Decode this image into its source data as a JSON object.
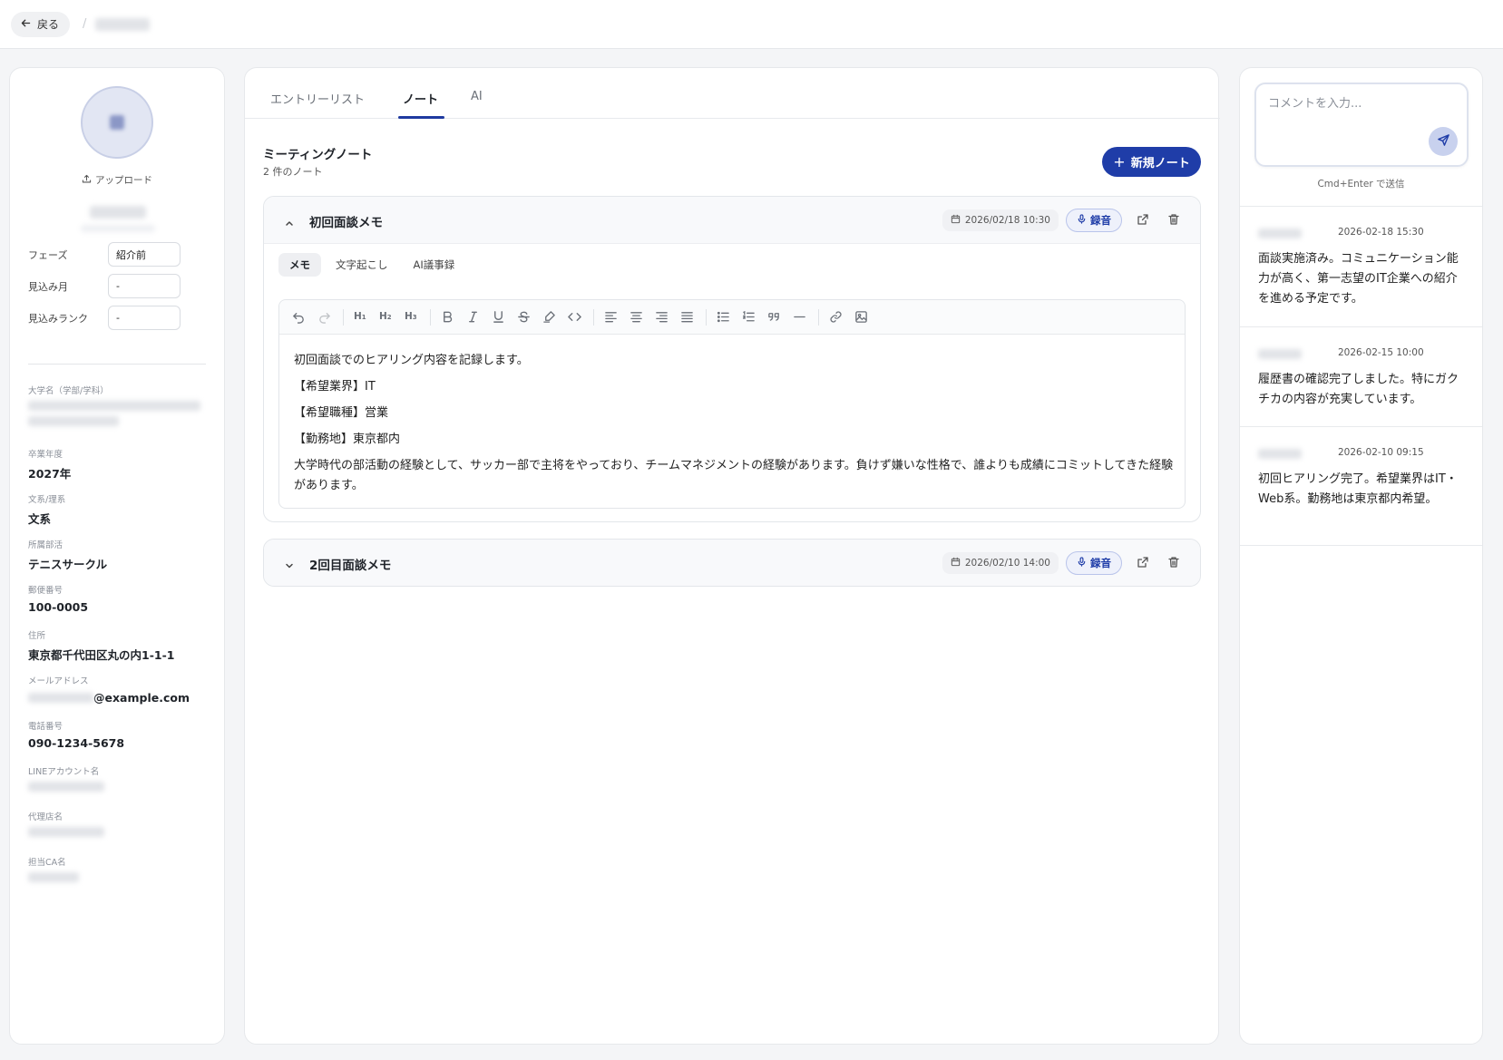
{
  "header": {
    "back_label": "戻る",
    "breadcrumb_separator": "/"
  },
  "profile": {
    "upload_label": "アップロード",
    "fields": [
      {
        "label": "フェーズ",
        "value": "紹介前"
      },
      {
        "label": "見込み月",
        "value": "-"
      },
      {
        "label": "見込みランク",
        "value": "-"
      }
    ],
    "info": {
      "university_label": "大学名（学部/学科）",
      "grad_year_label": "卒業年度",
      "grad_year": "2027年",
      "track_label": "文系/理系",
      "track": "文系",
      "club_label": "所属部活",
      "club": "テニスサークル",
      "postal_label": "郵便番号",
      "postal": "100-0005",
      "address_label": "住所",
      "address": "東京都千代田区丸の内1-1-1",
      "email_label": "メールアドレス",
      "email_domain": "@example.com",
      "phone_label": "電話番号",
      "phone": "090-1234-5678",
      "line_label": "LINEアカウント名",
      "agency_label": "代理店名",
      "ca_label": "担当CA名"
    }
  },
  "tabs": [
    {
      "label": "エントリーリスト"
    },
    {
      "label": "ノート"
    },
    {
      "label": "AI"
    }
  ],
  "notes_section": {
    "title": "ミーティングノート",
    "count": "2 件のノート",
    "new_button": "新規ノート",
    "plus": "+"
  },
  "notes": [
    {
      "title": "初回面談メモ",
      "date": "2026/02/18 10:30",
      "record_label": "録音",
      "subtabs": [
        "メモ",
        "文字起こし",
        "AI議事録"
      ],
      "toolbar": {
        "h1": "H",
        "h2": "H",
        "h3": "H",
        "n1": "1",
        "n2": "2",
        "n3": "3"
      },
      "body": [
        "初回面談でのヒアリング内容を記録します。",
        "【希望業界】IT",
        "【希望職種】営業",
        "【勤務地】東京都内",
        "大学時代の部活動の経験として、サッカー部で主将をやっており、チームマネジメントの経験があります。負けず嫌いな性格で、誰よりも成績にコミットしてきた経験があります。"
      ]
    },
    {
      "title": "2回目面談メモ",
      "date": "2026/02/10 14:00",
      "record_label": "録音"
    }
  ],
  "comments": {
    "placeholder": "コメントを入力...",
    "hint": "Cmd+Enter で送信",
    "items": [
      {
        "time": "2026-02-18 15:30",
        "text": "面談実施済み。コミュニケーション能力が高く、第一志望のIT企業への紹介を進める予定です。"
      },
      {
        "time": "2026-02-15 10:00",
        "text": "履歴書の確認完了しました。特にガクチカの内容が充実しています。"
      },
      {
        "time": "2026-02-10 09:15",
        "text": "初回ヒアリング完了。希望業界はIT・Web系。勤務地は東京都内希望。"
      }
    ]
  },
  "colors": {
    "accent": "#1f3da8",
    "accent_soft": "#eef1fb",
    "background": "#f4f5f7"
  }
}
